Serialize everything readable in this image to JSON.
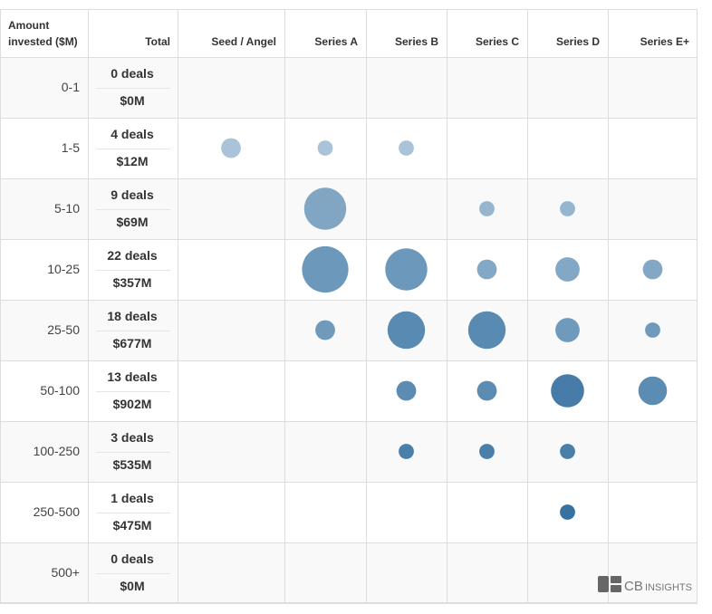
{
  "chart_data": {
    "type": "table",
    "header": {
      "row_label_line1": "Amount",
      "row_label_line2": "invested ($M)",
      "total_label": "Total"
    },
    "stages": [
      "Seed / Angel",
      "Series A",
      "Series B",
      "Series C",
      "Series D",
      "Series E+"
    ],
    "rows": [
      {
        "range": "0-1",
        "deals": "0 deals",
        "amount": "$0M",
        "bubbles": [
          0,
          0,
          0,
          0,
          0,
          0
        ]
      },
      {
        "range": "1-5",
        "deals": "4 deals",
        "amount": "$12M",
        "bubbles": [
          2,
          1,
          1,
          0,
          0,
          0
        ]
      },
      {
        "range": "5-10",
        "deals": "9 deals",
        "amount": "$69M",
        "bubbles": [
          0,
          7,
          0,
          1,
          1,
          0
        ]
      },
      {
        "range": "10-25",
        "deals": "22 deals",
        "amount": "$357M",
        "bubbles": [
          0,
          8,
          7,
          2,
          3,
          2
        ]
      },
      {
        "range": "25-50",
        "deals": "18 deals",
        "amount": "$677M",
        "bubbles": [
          0,
          2,
          6,
          6,
          3,
          1
        ]
      },
      {
        "range": "50-100",
        "deals": "13 deals",
        "amount": "$902M",
        "bubbles": [
          0,
          0,
          2,
          2,
          5,
          4
        ]
      },
      {
        "range": "100-250",
        "deals": "3 deals",
        "amount": "$535M",
        "bubbles": [
          0,
          0,
          1,
          1,
          1,
          0
        ]
      },
      {
        "range": "250-500",
        "deals": "1 deals",
        "amount": "$475M",
        "bubbles": [
          0,
          0,
          0,
          0,
          1,
          0
        ]
      },
      {
        "range": "500+",
        "deals": "0 deals",
        "amount": "$0M",
        "bubbles": [
          0,
          0,
          0,
          0,
          0,
          0
        ]
      }
    ],
    "color_scale": {
      "light": "#b9cfe1",
      "dark": "#1b5e92"
    },
    "watermark": {
      "brand_a": "CB",
      "brand_b": "INSIGHTS"
    }
  }
}
